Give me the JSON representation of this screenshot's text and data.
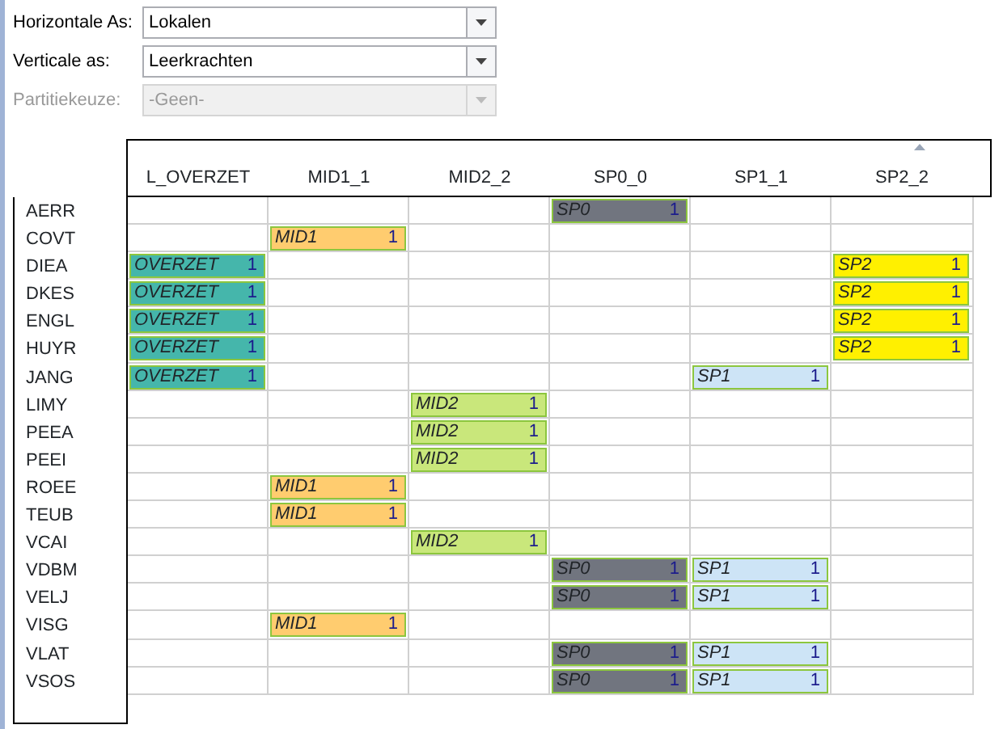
{
  "form": [
    {
      "label": "Horizontale As:",
      "value": "Lokalen",
      "disabled": false
    },
    {
      "label": "Verticale as:",
      "value": "Leerkrachten",
      "disabled": false
    },
    {
      "label": "Partitiekeuze:",
      "value": "-Geen-",
      "disabled": true
    }
  ],
  "columns": [
    "L_OVERZET",
    "MID1_1",
    "MID2_2",
    "SP0_0",
    "SP1_1",
    "SP2_2"
  ],
  "rows": [
    {
      "label": "AERR",
      "cells": [
        {},
        {},
        {},
        {
          "tag": "SP0",
          "count": "1",
          "color": "#71757f"
        },
        {},
        {}
      ]
    },
    {
      "label": "COVT",
      "cells": [
        {},
        {
          "tag": "MID1",
          "count": "1",
          "color": "#ffcc6f"
        },
        {},
        {},
        {},
        {}
      ]
    },
    {
      "label": "DIEA",
      "cells": [
        {
          "tag": "OVERZET",
          "count": "1",
          "color": "#45b6ab"
        },
        {},
        {},
        {},
        {},
        {
          "tag": "SP2",
          "count": "1",
          "color": "#fff000"
        }
      ]
    },
    {
      "label": "DKES",
      "cells": [
        {
          "tag": "OVERZET",
          "count": "1",
          "color": "#45b6ab"
        },
        {},
        {},
        {},
        {},
        {
          "tag": "SP2",
          "count": "1",
          "color": "#fff000"
        }
      ]
    },
    {
      "label": "ENGL",
      "cells": [
        {
          "tag": "OVERZET",
          "count": "1",
          "color": "#45b6ab"
        },
        {},
        {},
        {},
        {},
        {
          "tag": "SP2",
          "count": "1",
          "color": "#fff000"
        }
      ]
    },
    {
      "label": "HUYR",
      "cells": [
        {
          "tag": "OVERZET",
          "count": "1",
          "color": "#45b6ab"
        },
        {},
        {},
        {},
        {},
        {
          "tag": "SP2",
          "count": "1",
          "color": "#fff000"
        }
      ]
    },
    {
      "label": "JANG",
      "cells": [
        {
          "tag": "OVERZET",
          "count": "1",
          "color": "#45b6ab"
        },
        {},
        {},
        {},
        {
          "tag": "SP1",
          "count": "1",
          "color": "#cde4f6"
        },
        {}
      ]
    },
    {
      "label": "LIMY",
      "cells": [
        {},
        {},
        {
          "tag": "MID2",
          "count": "1",
          "color": "#c9e77b"
        },
        {},
        {},
        {}
      ]
    },
    {
      "label": "PEEA",
      "cells": [
        {},
        {},
        {
          "tag": "MID2",
          "count": "1",
          "color": "#c9e77b"
        },
        {},
        {},
        {}
      ]
    },
    {
      "label": "PEEI",
      "cells": [
        {},
        {},
        {
          "tag": "MID2",
          "count": "1",
          "color": "#c9e77b"
        },
        {},
        {},
        {}
      ]
    },
    {
      "label": "ROEE",
      "cells": [
        {},
        {
          "tag": "MID1",
          "count": "1",
          "color": "#ffcc6f"
        },
        {},
        {},
        {},
        {}
      ]
    },
    {
      "label": "TEUB",
      "cells": [
        {},
        {
          "tag": "MID1",
          "count": "1",
          "color": "#ffcc6f"
        },
        {},
        {},
        {},
        {}
      ]
    },
    {
      "label": "VCAI",
      "cells": [
        {},
        {},
        {
          "tag": "MID2",
          "count": "1",
          "color": "#c9e77b"
        },
        {},
        {},
        {}
      ]
    },
    {
      "label": "VDBM",
      "cells": [
        {},
        {},
        {},
        {
          "tag": "SP0",
          "count": "1",
          "color": "#71757f"
        },
        {
          "tag": "SP1",
          "count": "1",
          "color": "#cde4f6"
        },
        {}
      ]
    },
    {
      "label": "VELJ",
      "cells": [
        {},
        {},
        {},
        {
          "tag": "SP0",
          "count": "1",
          "color": "#71757f"
        },
        {
          "tag": "SP1",
          "count": "1",
          "color": "#cde4f6"
        },
        {}
      ]
    },
    {
      "label": "VISG",
      "cells": [
        {},
        {
          "tag": "MID1",
          "count": "1",
          "color": "#ffcc6f"
        },
        {},
        {},
        {},
        {}
      ]
    },
    {
      "label": "VLAT",
      "cells": [
        {},
        {},
        {},
        {
          "tag": "SP0",
          "count": "1",
          "color": "#71757f"
        },
        {
          "tag": "SP1",
          "count": "1",
          "color": "#cde4f6"
        },
        {}
      ]
    },
    {
      "label": "VSOS",
      "cells": [
        {},
        {},
        {},
        {
          "tag": "SP0",
          "count": "1",
          "color": "#71757f"
        },
        {
          "tag": "SP1",
          "count": "1",
          "color": "#cde4f6"
        },
        {}
      ]
    }
  ]
}
